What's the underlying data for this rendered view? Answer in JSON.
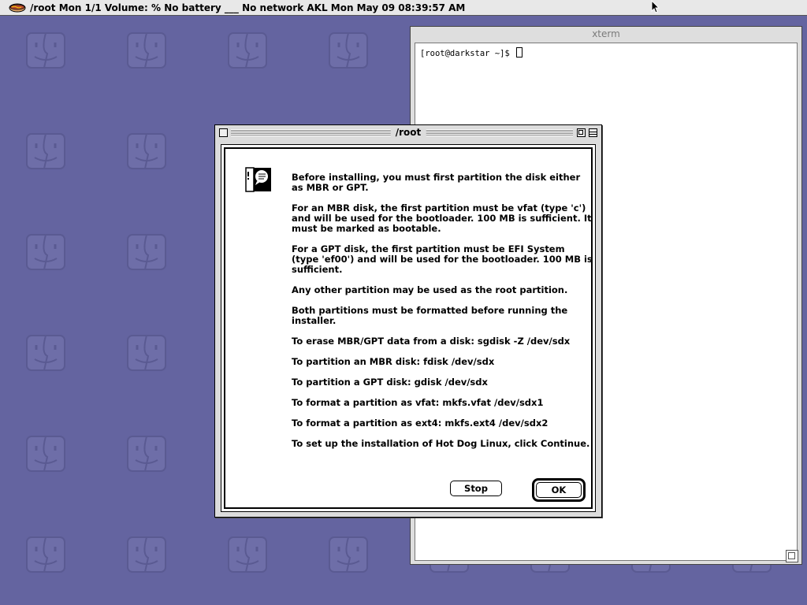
{
  "menubar": {
    "text": "/root Mon 1/1 Volume: % No battery ___ No network AKL Mon May 09 08:39:57 AM",
    "logo_icon": "hotdog-icon"
  },
  "xterm": {
    "title": "xterm",
    "prompt": "[root@darkstar ~]$"
  },
  "dialog": {
    "title": "/root",
    "icon": "note-icon",
    "paragraphs": [
      "Before installing, you must first partition the disk either as MBR or GPT.",
      "For an MBR disk, the first partition must be vfat (type 'c') and will be used for the bootloader. 100 MB is sufficient. It must be marked as bootable.",
      "For a GPT disk, the first partition must be EFI System (type 'ef00') and will be used for the bootloader. 100 MB is sufficient.",
      "Any other partition may be used as the root partition.",
      "Both partitions must be formatted before running the installer.",
      "To erase MBR/GPT data from a disk: sgdisk -Z /dev/sdx",
      "To partition an MBR disk: fdisk /dev/sdx",
      "To partition a GPT disk: gdisk /dev/sdx",
      "To format a partition as vfat: mkfs.vfat /dev/sdx1",
      "To format a partition as ext4: mkfs.ext4 /dev/sdx2",
      "To set up the installation of Hot Dog Linux, click Continue."
    ],
    "stop_label": "Stop",
    "ok_label": "OK"
  },
  "colors": {
    "desktop": "#6464a0",
    "menubar": "#e8e8e8",
    "window_frame": "#dcdcdc"
  }
}
